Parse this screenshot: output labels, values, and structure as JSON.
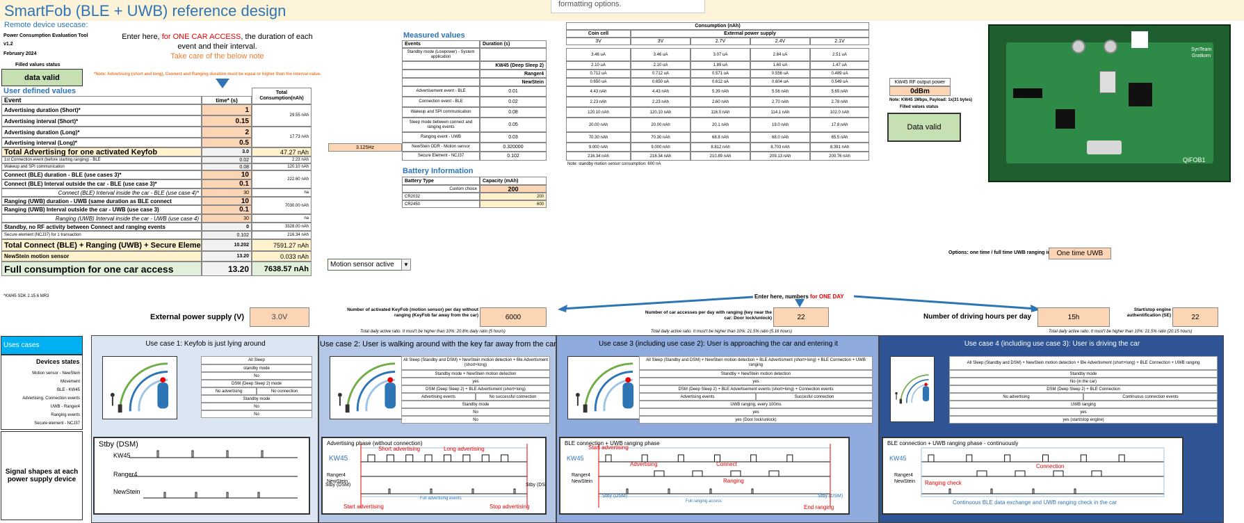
{
  "title": "SmartFob (BLE + UWB) reference design",
  "remote_label": "Remote device usecase:",
  "tooltip": "formatting options.",
  "tool": {
    "name": "Power Consumption Evaluation Tool",
    "version": "v1.2",
    "date": "February 2024",
    "filled_status_label": "Filled values status",
    "status": "data valid"
  },
  "instructions": {
    "line1": "Enter here, ",
    "highlight": "for ONE CAR ACCESS",
    "line2": ", the duration of each event and their interval.",
    "note": "Take care of the below note",
    "note_text": "*Note: Advertising (short and long), Connect and Ranging duration must be equal or higher than the interval value."
  },
  "user_defined": {
    "title": "User defined values",
    "col_time": "time* (s)",
    "col_total": "Total Consumption(nAh)",
    "col_event": "Event",
    "rows": [
      {
        "label": "Advertising duration (Short)*",
        "value": "1",
        "total": ""
      },
      {
        "label": "Advertising interval (Short)*",
        "value": "0.15",
        "total": "29.55 nAh"
      },
      {
        "label": "Advertising duration (Long)*",
        "value": "2",
        "total": ""
      },
      {
        "label": "Advertising interval (Long)*",
        "value": "0.5",
        "total": "17.73 nAh"
      },
      {
        "label": "Total Advertising for one activated Keyfob",
        "value": "3.0",
        "total": "47.27 nAh"
      },
      {
        "label": "1st Connection event (before starting ranging) - BLE",
        "value": "0.02",
        "total": "2.23 nAh"
      },
      {
        "label": "Wakeup and SPI communication",
        "value": "0.08",
        "total": "120.10 nAh"
      },
      {
        "label": "Connect (BLE) duration - BLE (use cases 3)*",
        "value": "10",
        "total": ""
      },
      {
        "label": "Connect (BLE) Interval outside the car - BLE (use case 3)*",
        "value": "0.1",
        "total": "222.60 nAh"
      },
      {
        "label": "Connect (BLE) Interval inside the car - BLE (use case 4)*",
        "value": "30",
        "total": "na"
      },
      {
        "label": "Ranging (UWB) duration - UWB (same duration as BLE connect",
        "value": "10",
        "total": ""
      },
      {
        "label": "Ranging (UWB) Interval outside the car - UWB (use case 3)",
        "value": "0.1",
        "total": "7030.00 nAh"
      },
      {
        "label": "Ranging (UWB) Interval inside the car - UWB (use case 4)",
        "value": "30",
        "total": "na"
      },
      {
        "label": "Standby, no RF activity between Connect and ranging events",
        "value": "0",
        "total": "3328.00 nAh"
      },
      {
        "label": "Secure element (NCJ37) for 1 transaction",
        "value": "0.102",
        "total": "216.34 nAh"
      },
      {
        "label": "Total Connect (BLE) + Ranging (UWB) + Secure Element",
        "value": "10.202",
        "total": "7591.27 nAh"
      },
      {
        "label": "NewStein motion sensor",
        "value": "13.20",
        "total": "0.033 nAh"
      },
      {
        "label": "Full consumption for one car access",
        "value": "13.20",
        "total": "7638.57 nAh"
      }
    ],
    "sdk": "*KW45 SDK 2.15.6 MR3"
  },
  "measured": {
    "title": "Measured values",
    "col_event": "Events",
    "col_duration": "Duration (s)",
    "rows": [
      {
        "label": "Standby mode (Lowpower) - System application",
        "value": ""
      },
      {
        "label": "",
        "value": "KW45 (Deep Sleep 2)"
      },
      {
        "label": "",
        "value": "Ranger4"
      },
      {
        "label": "",
        "value": "NewStein"
      },
      {
        "label": "Advertisement event - BLE",
        "value": "0.01"
      },
      {
        "label": "Connection event - BLE",
        "value": "0.02"
      },
      {
        "label": "Wakeup and SPI communication",
        "value": "0.08"
      },
      {
        "label": "Sleep mode between connect and ranging events",
        "value": "0.05"
      },
      {
        "label": "Ranging event - UWB",
        "value": "0.03"
      },
      {
        "label": "NewStein ODR - Motion sensor",
        "value": "0.320000"
      },
      {
        "label": "Secure Element - NCJ37",
        "value": "0.102"
      }
    ],
    "odr": "3.125Hz"
  },
  "consumption": {
    "title": "Consumption (nAh)",
    "coin_cell": "Coin cell",
    "external": "External power supply",
    "voltages": [
      "3V",
      "3V",
      "2.7V",
      "2.4V",
      "2.1V"
    ],
    "rows": [
      [
        "3.46 uA",
        "3.46 uA",
        "3.07 uA",
        "2.84 uA",
        "2.51 uA"
      ],
      [
        "2.10 uA",
        "2.10 uA",
        "1.89 uA",
        "1.60 uA",
        "1.47 uA"
      ],
      [
        "0.712 uA",
        "0.712 uA",
        "0.571 uA",
        "0.556 uA",
        "0.489 uA"
      ],
      [
        "0.650 uA",
        "0.650 uA",
        "0.612 uA",
        "0.604 uA",
        "0.549 uA"
      ],
      [
        "4.43 nAh",
        "4.43 nAh",
        "5.39 nAh",
        "5.56 nAh",
        "5.65 nAh"
      ],
      [
        "2.23 nAh",
        "2.23 nAh",
        "2.60 nAh",
        "2.70 nAh",
        "2.78 nAh"
      ],
      [
        "120.10 nAh",
        "120.10 nAh",
        "116.0 nAh",
        "114.1 nAh",
        "102.0 nAh"
      ],
      [
        "20.00 nAh",
        "20.00 nAh",
        "20.1 nAh",
        "19.0 nAh",
        "17.8 nAh"
      ],
      [
        "70.30 nAh",
        "70.30 nAh",
        "68.8 nAh",
        "68.0 nAh",
        "65.5 nAh"
      ],
      [
        "9.000 nAh",
        "9.000 nAh",
        "8.812 nAh",
        "8.703 nAh",
        "8.391 nAh"
      ],
      [
        "216.34 nAh",
        "216.34 nAh",
        "210.89 nAh",
        "209.13 nAh",
        "200.76 nAh"
      ]
    ],
    "note": "Note: standby motion sensor consumption: 600 nA"
  },
  "battery": {
    "title": "Battery Information",
    "col_type": "Battery Type",
    "col_capacity": "Capacity (mAh)",
    "rows": [
      [
        "Custom choice",
        "200"
      ],
      [
        "CR2032",
        "200"
      ],
      [
        "CR2450",
        "600"
      ]
    ]
  },
  "rf": {
    "label": "KW45 RF output power",
    "value": "0dBm",
    "note": "Note: KW45 1Mbps, Payload: 1x(31 bytes)",
    "status_label": "Filled values status",
    "status": "Data valid"
  },
  "board": {
    "brand1": "SynTeam",
    "brand2": "Gratkorn",
    "code": "QiFOB1"
  },
  "motion_select": "Motion sensor active",
  "options": {
    "label": "Options: one time / full time UWB ranging inside the car",
    "value": "One time UWB"
  },
  "day": {
    "prefix": "Enter here, numbers ",
    "highlight": "for ONE DAY"
  },
  "ext_supply": {
    "label": "External power supply (V)",
    "value": "3.0V"
  },
  "keyfob": {
    "label": "Number of activated KeyFob (motion sensor) per day without ranging (KeyFob far away from the car)",
    "value": "6000",
    "sub": "Total daily active ratio. It must't be higher than 10%:",
    "ratio": "20.8% daily ratio (5 hours)"
  },
  "accesses": {
    "label": "Number of car accesses per day with ranging (key near the car: Door lock/unlock)",
    "value": "22",
    "sub": "Total daily active ratio. It must't be higher than 10%:",
    "ratio": "21.5% ratio (5.16 hours)"
  },
  "driving": {
    "label": "Number of driving hours per day",
    "value": "15h"
  },
  "engine": {
    "label": "Start/stop engine authentification (SE)",
    "value": "22",
    "sub": "Total daily active ratio. It must't be higher than 10%:",
    "ratio": "21.5% ratio (20.15 hours)"
  },
  "side": {
    "use_cases": "Uses cases",
    "device_states": "Devices states",
    "rows": [
      "Motion sensor - NewStein",
      "Movement",
      "BLE - KW45",
      "Advertising, Connection events",
      "UWB - Ranger4",
      "Ranging events",
      "Secure element - NCJ37"
    ],
    "signal": "Signal shapes at each power supply device"
  },
  "usecases": [
    {
      "title": "Use case 1: Keyfob is just lying around",
      "states": [
        "All Sleep",
        "standby mode",
        "No",
        "DSM (Deep Sleep 2) mode",
        "No advertising|No connection",
        "Standby mode",
        "No",
        "No"
      ],
      "plot_title": "Stby (DSM)"
    },
    {
      "title": "Use case 2: User is walking around with the key far away from the car",
      "states": [
        "All Sleep (Standby and DSM) + NewStein motion detection + Ble Advertisment (short+long)",
        "Standby mode + NewStein motion detection",
        "yes",
        "DSM (Deep Sleep 2) + BLE Advertisment (short+long)",
        "Advertising events|No successful connection",
        "Standby mode",
        "No",
        "No"
      ],
      "plot_title": "Advertising phase (without connection)"
    },
    {
      "title": "Use case 3 (including use case 2): User is approaching the car and entering it",
      "states": [
        "All Sleep (Standby and DSM) + NewStein motion detection + BLE Advertisment (short+long) + BLE Connection + UWB ranging",
        "Standby + NewStein motion detection",
        "yes",
        "DSM (Deep Sleep 2) + BLE Advertisement events (short+long) + Connection events",
        "Advertising events|Succesful connection",
        "UWB ranging, every 100ms",
        "yes",
        "yes (Door lock/unlock)"
      ],
      "plot_title": "BLE connection + UWB ranging phase"
    },
    {
      "title": "Use case 4 (including use case 3): User is driving the car",
      "states": [
        "All Sleep (Standby and DSM) + NewStein motion detection + Ble Advertisment (short+long) + BLE Connection + UWB ranging",
        "Standby mode",
        "No (in the car)",
        "DSM (Deep Sleep 2) + BLE Connection",
        "No advertising|Continuous connection events",
        "UWB ranging",
        "yes",
        "yes (start/stop engine)"
      ],
      "plot_title": "BLE connection + UWB ranging phase - continuously"
    }
  ],
  "plot_labels": {
    "kw45": "KW45",
    "ranger4": "Ranger4",
    "newstein": "NewStein",
    "short_adv": "Short advertising",
    "long_adv": "Long advertising",
    "start_adv": "Start advertising",
    "stop_adv": "Stop advertising",
    "advertising": "Advertising",
    "connect": "Connect",
    "ranging": "Ranging",
    "end_ranging": "End ranging",
    "connection": "Connection",
    "ranging_check": "Ranging check",
    "continuous": "Continuous BLE data exchange and UWB ranging check in the car",
    "stby_dsm": "Stby (DSM)",
    "full_adv": "Full advertising events",
    "full_ranging": "Full ranging access"
  },
  "colors": {
    "accent": "#2e75b6",
    "peach": "#fcd5b4",
    "green": "#c6e0b4",
    "red": "#e60000",
    "uc1": "#dce6f2",
    "uc2": "#b4c7e7",
    "uc3": "#8faadc",
    "uc4": "#2f5597"
  }
}
